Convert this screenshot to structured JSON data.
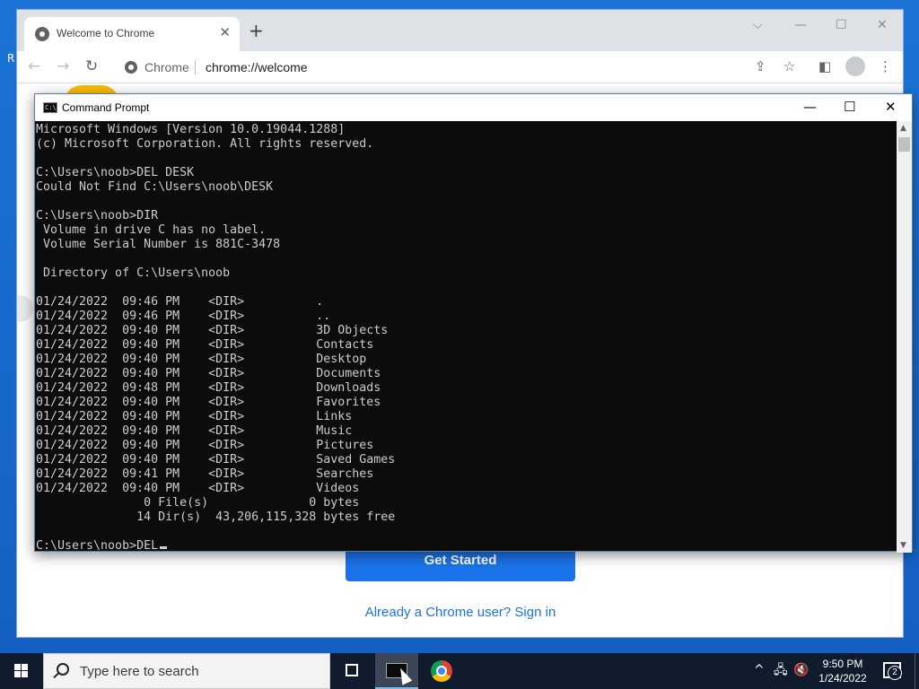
{
  "desktop": {
    "edge_letter": "R"
  },
  "chrome": {
    "tab_title": "Welcome to Chrome",
    "tab_close": "✕",
    "new_tab": "+",
    "window_controls": {
      "dropdown": "⌵",
      "minimize": "—",
      "maximize": "☐",
      "close": "✕"
    },
    "nav": {
      "back": "←",
      "forward": "→",
      "reload": "↻"
    },
    "omnibox": {
      "chip": "Chrome",
      "url": "chrome://welcome"
    },
    "toolbar_icons": {
      "share": "⇪",
      "bookmark": "☆",
      "sidepanel": "◧",
      "menu": "⋮"
    },
    "page": {
      "get_started": "Get Started",
      "signin_link": "Already a Chrome user? Sign in"
    }
  },
  "cmd": {
    "title": "Command Prompt",
    "icon_text": "C:\\",
    "controls": {
      "minimize": "—",
      "maximize": "☐",
      "close": "✕"
    },
    "lines": [
      "Microsoft Windows [Version 10.0.19044.1288]",
      "(c) Microsoft Corporation. All rights reserved.",
      "",
      "C:\\Users\\noob>DEL DESK",
      "Could Not Find C:\\Users\\noob\\DESK",
      "",
      "C:\\Users\\noob>DIR",
      " Volume in drive C has no label.",
      " Volume Serial Number is 881C-3478",
      "",
      " Directory of C:\\Users\\noob",
      "",
      "01/24/2022  09:46 PM    <DIR>          .",
      "01/24/2022  09:46 PM    <DIR>          ..",
      "01/24/2022  09:40 PM    <DIR>          3D Objects",
      "01/24/2022  09:40 PM    <DIR>          Contacts",
      "01/24/2022  09:40 PM    <DIR>          Desktop",
      "01/24/2022  09:40 PM    <DIR>          Documents",
      "01/24/2022  09:48 PM    <DIR>          Downloads",
      "01/24/2022  09:40 PM    <DIR>          Favorites",
      "01/24/2022  09:40 PM    <DIR>          Links",
      "01/24/2022  09:40 PM    <DIR>          Music",
      "01/24/2022  09:40 PM    <DIR>          Pictures",
      "01/24/2022  09:40 PM    <DIR>          Saved Games",
      "01/24/2022  09:41 PM    <DIR>          Searches",
      "01/24/2022  09:40 PM    <DIR>          Videos",
      "               0 File(s)              0 bytes",
      "              14 Dir(s)  43,206,115,328 bytes free",
      ""
    ],
    "prompt": "C:\\Users\\noob>DEL"
  },
  "taskbar": {
    "search_placeholder": "Type here to search",
    "tray": {
      "chevron": "^",
      "network": "🖧",
      "volume": "🔇"
    },
    "clock": {
      "time": "9:50 PM",
      "date": "1/24/2022"
    },
    "notification_count": "2"
  }
}
